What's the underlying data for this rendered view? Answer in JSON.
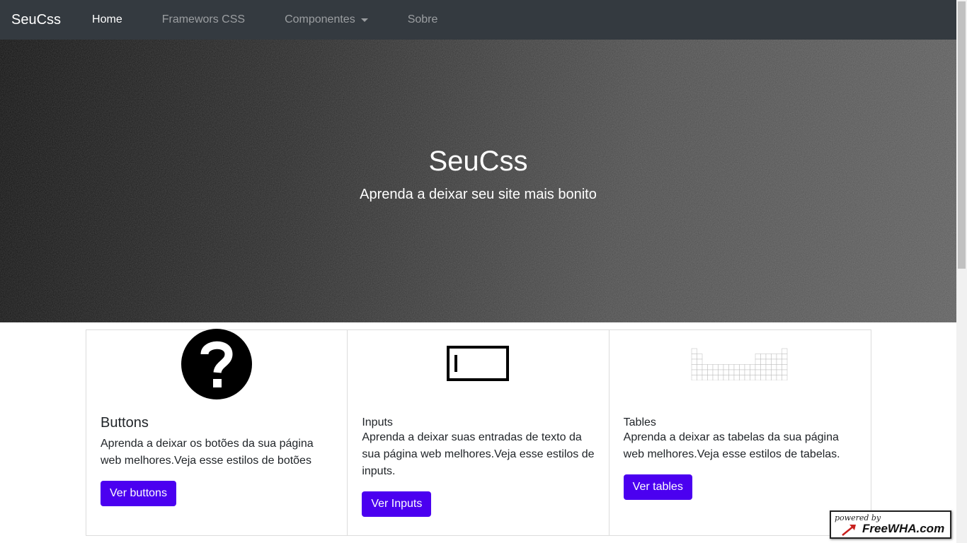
{
  "navbar": {
    "brand": "SeuCss",
    "links": [
      {
        "label": "Home",
        "active": true
      },
      {
        "label": "Framewors CSS",
        "active": false
      },
      {
        "label": "Componentes",
        "active": false,
        "dropdown": true
      },
      {
        "label": "Sobre",
        "active": false
      }
    ]
  },
  "hero": {
    "title": "SeuCss",
    "subtitle": "Aprenda a deixar seu site mais bonito"
  },
  "cards": [
    {
      "icon": "question-circle-icon",
      "title": "Buttons",
      "text": "Aprenda a deixar os botões da sua página web melhores.Veja esse estilos de botões",
      "button": "Ver buttons"
    },
    {
      "icon": "text-input-icon",
      "title": "Inputs",
      "text": "Aprenda a deixar suas entradas de texto da sua página web melhores.Veja esse estilos de inputs.",
      "button": "Ver Inputs"
    },
    {
      "icon": "periodic-table-icon",
      "title": "Tables",
      "text": "Aprenda a deixar as tabelas da sua página web melhores.Veja esse estilos de tabelas.",
      "button": "Ver tables"
    }
  ],
  "badge": {
    "powered": "powered by",
    "name": "FreeWHA.com"
  },
  "colors": {
    "navbar_bg": "#343a40",
    "button_bg": "#4b00f0"
  }
}
